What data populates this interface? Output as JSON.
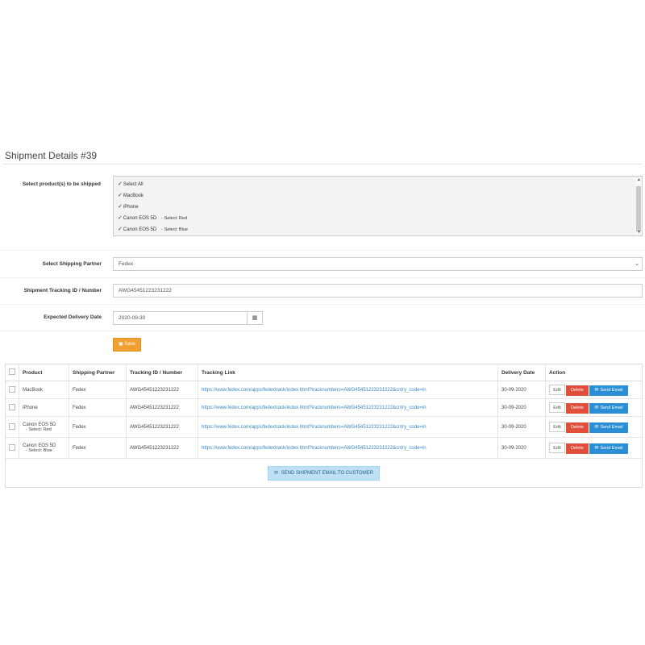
{
  "heading": "Shipment Details #39",
  "form": {
    "products_label": "Select product(s) to be shipped",
    "product_options": [
      {
        "label": "Select All",
        "sub": ""
      },
      {
        "label": "MacBook",
        "sub": ""
      },
      {
        "label": "iPhone",
        "sub": ""
      },
      {
        "label": "Canon EOS 5D",
        "sub": "- Select: Red"
      },
      {
        "label": "Canon EOS 5D",
        "sub": "- Select: Blue"
      }
    ],
    "partner_label": "Select Shipping Partner",
    "partner_value": "Fedex",
    "tracking_label": "Shipment Tracking ID / Number",
    "tracking_value": "AWG45451223231222",
    "delivery_label": "Expected Delivery Date",
    "delivery_value": "2020-09-30",
    "save_label": "Save"
  },
  "table": {
    "headers": [
      "Product",
      "Shipping Partner",
      "Tracking ID / Number",
      "Tracking Link",
      "Delivery Date",
      "Action"
    ],
    "rows": [
      {
        "product": "MacBook",
        "sub": "",
        "partner": "Fedex",
        "tracking": "AWG45451223231222",
        "link": "https://www.fedex.com/apps/fedextrack/index.html?tracknumbers=AWG45451223231222&cntry_code=in",
        "date": "30-09-2020"
      },
      {
        "product": "iPhone",
        "sub": "",
        "partner": "Fedex",
        "tracking": "AWG45451223231222",
        "link": "https://www.fedex.com/apps/fedextrack/index.html?tracknumbers=AWG45451223231222&cntry_code=in",
        "date": "30-09-2020"
      },
      {
        "product": "Canon EOS 5D",
        "sub": "- Select: Red",
        "partner": "Fedex",
        "tracking": "AWG45451223231222",
        "link": "https://www.fedex.com/apps/fedextrack/index.html?tracknumbers=AWG45451223231222&cntry_code=in",
        "date": "30-09-2020"
      },
      {
        "product": "Canon EOS 5D",
        "sub": "- Select: Blue",
        "partner": "Fedex",
        "tracking": "AWG45451223231222",
        "link": "https://www.fedex.com/apps/fedextrack/index.html?tracknumbers=AWG45451223231222&cntry_code=in",
        "date": "30-09-2020"
      }
    ],
    "edit_label": "Edit",
    "delete_label": "Delete",
    "email_label": "Send Email"
  },
  "send_all_label": "SEND SHIPMENT EMAIL TO CUSTOMER",
  "icons": {
    "check": "✓",
    "calendar": "▦",
    "save": "▣",
    "envelope": "✉",
    "caret": "⌄"
  },
  "colors": {
    "save": "#f0a030",
    "delete": "#e04e3c",
    "email": "#2a8fd4",
    "send_all": "#bde0f5",
    "link": "#3a87c8"
  }
}
